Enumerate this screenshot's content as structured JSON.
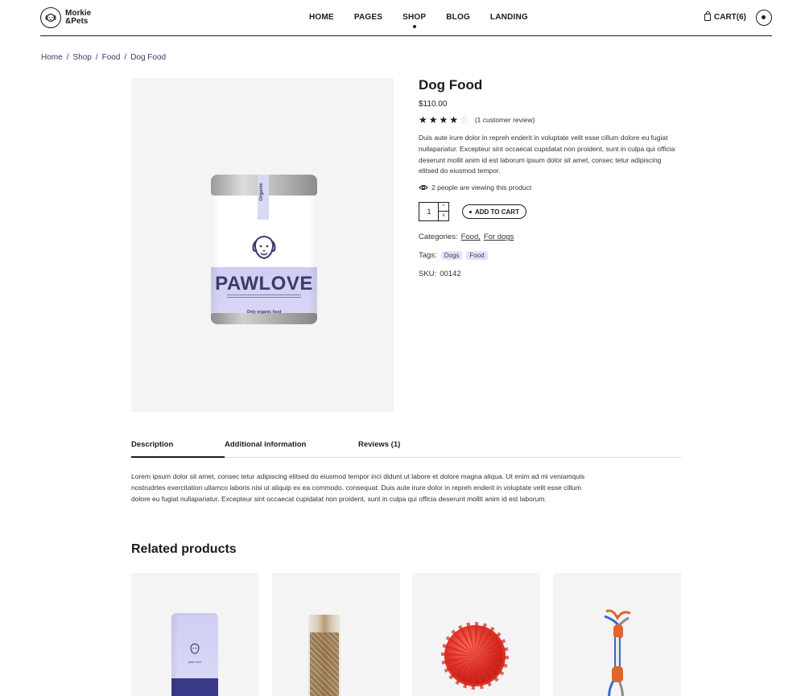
{
  "header": {
    "logo_line1": "Morkie",
    "logo_line2": "&Pets",
    "nav": [
      "HOME",
      "PAGES",
      "SHOP",
      "BLOG",
      "LANDING"
    ],
    "active_nav": "SHOP",
    "cart_label": "CART(6)"
  },
  "breadcrumb": [
    "Home",
    "Shop",
    "Food",
    "Dog Food"
  ],
  "product": {
    "image_tape_text": "Organic",
    "image_brand": "PAWLOVE",
    "image_footer": "Only organic food",
    "title": "Dog Food",
    "price": "$110.00",
    "rating": 4,
    "rating_max": 5,
    "review_text": "(1 customer review)",
    "description": "Duis aute irure dolor in repreh enderit in voluptate velit esse cillum dolore eu fugiat nullapariatur. Excepteur sint occaecat cupidatat non proident, sunt in culpa qui officia deserunt mollit anim id est laborum ipsum dolor sit amet, consec tetur adipiscing elitsed do eiusmod tempor.",
    "viewing": "2 people are viewing this product",
    "quantity": "1",
    "qty_up": "^",
    "qty_down": "v",
    "add_to_cart": "ADD TO CART",
    "categories_label": "Categories:",
    "categories": [
      "Food,",
      "For dogs"
    ],
    "tags_label": "Tags:",
    "tags": [
      "Dogs",
      "Food"
    ],
    "sku_label": "SKU:",
    "sku": "00142"
  },
  "tabs": {
    "items": [
      "Description",
      "Additional information",
      "Reviews (1)"
    ],
    "active": "Description",
    "content": "Lorem ipsum dolor sit amet, consec tetur adipiscing elitsed do eiusmod tempor inci didunt ut labore et dolore magna aliqua. Ut enim ad mi veniamquis nostrudrtes exercitation ullamco laboris nisi ut aliquip ex ea commodo. consequat. Duis aute irure dolor in repreh enderit in voluptate velit esse cillum dolore eu fugiat nullapariatur. Excepteur sint occaecat cupidatat non proident, sunt in culpa qui officia deserunt mollit anim id est laborum."
  },
  "related": {
    "title": "Related products",
    "items": [
      {
        "image": "pouch",
        "label": "paw love"
      },
      {
        "image": "bag"
      },
      {
        "image": "ball"
      },
      {
        "image": "rope"
      }
    ]
  },
  "colors": {
    "accent": "#3c3a6b",
    "tag_bg": "#e3e2f7",
    "image_bg": "#f4f4f4",
    "text": "#1c1c1c"
  }
}
